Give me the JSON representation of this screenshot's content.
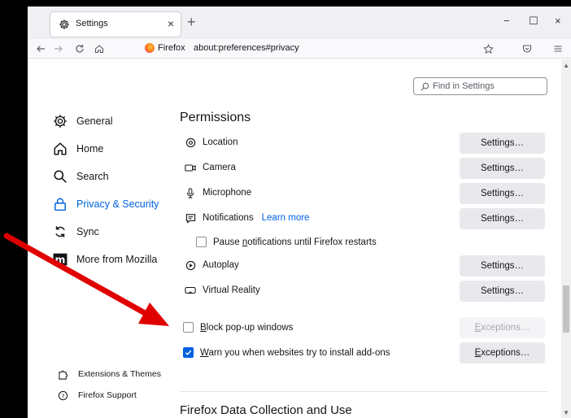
{
  "tab": {
    "title": "Settings",
    "icon": "gear-icon",
    "close": "×"
  },
  "new_tab": "+",
  "window_controls": {
    "minimize": "−",
    "maximize": "☐",
    "close": "×"
  },
  "navbar": {
    "identity_label": "Firefox",
    "url": "about:preferences#privacy"
  },
  "search": {
    "placeholder": "Find in Settings"
  },
  "sidebar": {
    "items": [
      {
        "label": "General",
        "icon": "gear-icon"
      },
      {
        "label": "Home",
        "icon": "home-icon"
      },
      {
        "label": "Search",
        "icon": "search-icon"
      },
      {
        "label": "Privacy & Security",
        "icon": "lock-icon",
        "active": true
      },
      {
        "label": "Sync",
        "icon": "sync-icon"
      },
      {
        "label": "More from Mozilla",
        "icon": "mozilla-icon"
      }
    ],
    "footer": [
      {
        "label": "Extensions & Themes",
        "icon": "puzzle-icon"
      },
      {
        "label": "Firefox Support",
        "icon": "help-icon"
      }
    ]
  },
  "permissions": {
    "title": "Permissions",
    "rows": [
      {
        "label": "Location",
        "icon": "location-icon",
        "button": "Settings…"
      },
      {
        "label": "Camera",
        "icon": "camera-icon",
        "button": "Settings…"
      },
      {
        "label": "Microphone",
        "icon": "microphone-icon",
        "button": "Settings…"
      },
      {
        "label": "Notifications",
        "icon": "notification-icon",
        "link": "Learn more",
        "button": "Settings…"
      },
      {
        "label": "Autoplay",
        "icon": "autoplay-icon",
        "button": "Settings…"
      },
      {
        "label": "Virtual Reality",
        "icon": "vr-icon",
        "button": "Settings…"
      }
    ],
    "pause_notifications": {
      "prefix": "Pause ",
      "accel": "n",
      "suffix": "otifications until Firefox restarts",
      "checked": false
    },
    "block_popups": {
      "accel": "B",
      "suffix": "lock pop-up windows",
      "checked": false,
      "button_accel": "E",
      "button_suffix": "xceptions…",
      "button_disabled": true
    },
    "warn_addons": {
      "accel": "W",
      "suffix": "arn you when websites try to install add-ons",
      "checked": true,
      "button_accel": "E",
      "button_suffix": "xceptions…"
    }
  },
  "next_section": {
    "title": "Firefox Data Collection and Use"
  },
  "colors": {
    "accent": "#0061e0",
    "annotation_arrow": "#e00000"
  }
}
